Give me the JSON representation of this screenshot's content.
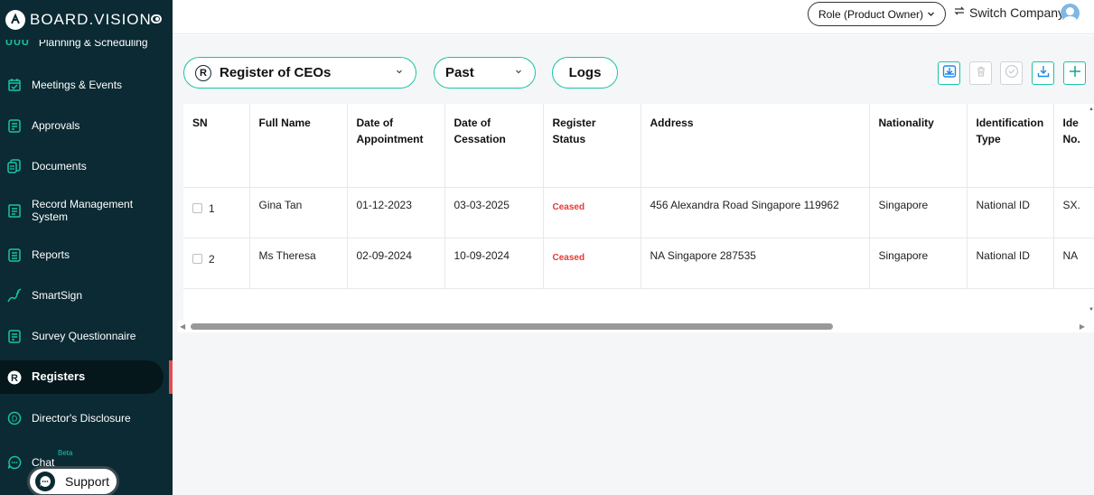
{
  "brand": {
    "name": "BOARD.VISION"
  },
  "sidebar": {
    "partial_item": "Planning & Scheduling",
    "items": [
      {
        "label": "Meetings & Events",
        "icon": "calendar-check-icon"
      },
      {
        "label": "Approvals",
        "icon": "approvals-icon"
      },
      {
        "label": "Documents",
        "icon": "documents-icon"
      },
      {
        "label": "Record Management System",
        "icon": "record-management-icon"
      },
      {
        "label": "Reports",
        "icon": "reports-icon"
      },
      {
        "label": "SmartSign",
        "icon": "pen-icon"
      },
      {
        "label": "Survey Questionnaire",
        "icon": "survey-icon"
      },
      {
        "label": "Registers",
        "icon": "registers-icon"
      },
      {
        "label": "Director's Disclosure",
        "icon": "disclosure-icon"
      },
      {
        "label": "Chat",
        "icon": "chat-icon",
        "badge": "Beta"
      }
    ],
    "active": "Registers",
    "support_label": "Support"
  },
  "topbar": {
    "role_label": "Role (Product Owner)",
    "switch_label": "Switch Company"
  },
  "toolbar": {
    "register_select": "Register of CEOs",
    "period_select": "Past",
    "logs_label": "Logs",
    "register_badge": "R"
  },
  "table": {
    "headers": [
      "SN",
      "Full Name",
      "Date of Appointment",
      "Date of Cessation",
      "Register Status",
      "Address",
      "Nationality",
      "Identification Type",
      "Ide No."
    ],
    "rows": [
      {
        "sn": "1",
        "full_name": "Gina Tan",
        "appointment": "01-12-2023",
        "cessation": "03-03-2025",
        "status": "Ceased",
        "address": "456 Alexandra Road Singapore 119962",
        "nationality": "Singapore",
        "id_type": "National ID",
        "id_no": "SX."
      },
      {
        "sn": "2",
        "full_name": "Ms Theresa",
        "appointment": "02-09-2024",
        "cessation": "10-09-2024",
        "status": "Ceased",
        "address": "NA Singapore 287535",
        "nationality": "Singapore",
        "id_type": "National ID",
        "id_no": "NA"
      }
    ]
  },
  "colors": {
    "sidebar_bg": "#0b2a33",
    "accent": "#18c4a6",
    "ceased": "#e53935",
    "active_marker": "#e05050"
  }
}
